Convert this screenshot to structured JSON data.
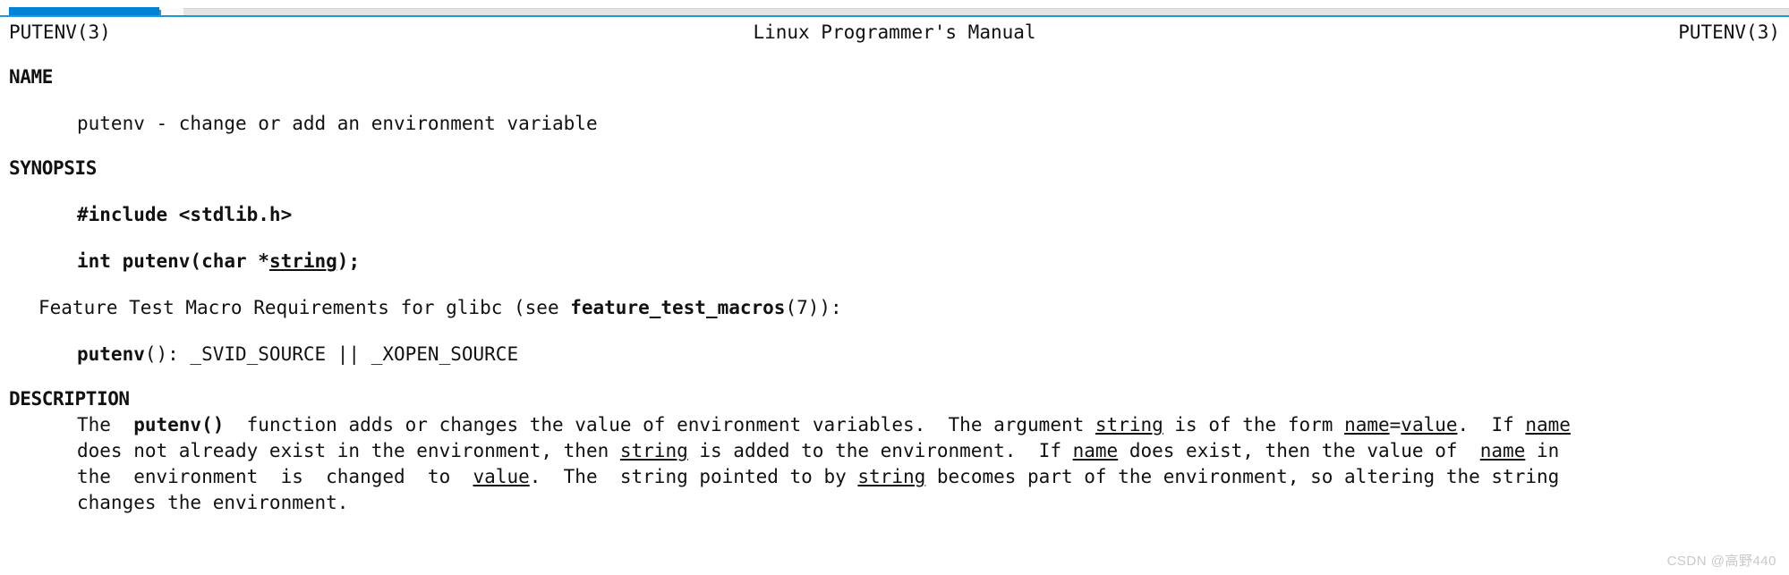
{
  "progress": {
    "fill_color": "#0081d6",
    "track_color": "#e2e4e6",
    "accent_color": "#2196d8",
    "percent": "8"
  },
  "man_header": {
    "left": "PUTENV(3)",
    "center": "Linux Programmer's Manual",
    "right": "PUTENV(3)"
  },
  "sections": {
    "name": {
      "title": "NAME",
      "body": "putenv - change or add an environment variable"
    },
    "synopsis": {
      "title": "SYNOPSIS",
      "include_line": "#include <stdlib.h>",
      "proto_pre": "int putenv(char *",
      "proto_param": "string",
      "proto_post": ");",
      "feature_pre": "Feature Test Macro Requirements for glibc (see ",
      "feature_macro": "feature_test_macros",
      "feature_post": "(7)):",
      "ftm_func": "putenv",
      "ftm_value": "(): _SVID_SOURCE || _XOPEN_SOURCE"
    },
    "description": {
      "title": "DESCRIPTION",
      "line1_a": "The  ",
      "line1_func": "putenv()",
      "line1_b": "  function adds or changes the value of environment variables.  The argument ",
      "line1_string": "string",
      "line1_c": " is of the form ",
      "line1_name": "name",
      "line1_eq": "=",
      "line1_value": "value",
      "line1_d": ".  If ",
      "line1_name2": "name",
      "line2_a": "does not already exist in the environment, then ",
      "line2_string": "string",
      "line2_b": " is added to the environment.  If ",
      "line2_name": "name",
      "line2_c": " does exist, then the value of  ",
      "line2_name2": "name",
      "line2_d": " in",
      "line3_a": "the  environment  is  changed  to  ",
      "line3_value": "value",
      "line3_b": ".  The  string pointed to by ",
      "line3_string": "string",
      "line3_c": " becomes part of the environment, so altering the string",
      "line4": "changes the environment."
    }
  },
  "watermark": "CSDN @高野440"
}
